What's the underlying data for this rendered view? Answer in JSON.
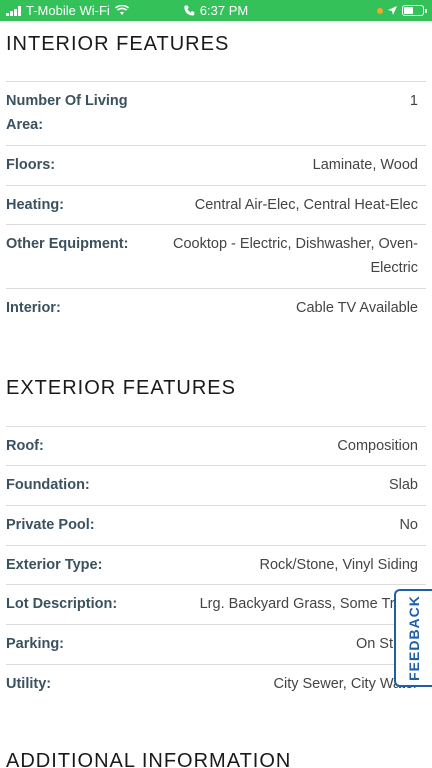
{
  "status_bar": {
    "carrier": "T-Mobile Wi-Fi",
    "time": "6:37 PM",
    "background_color": "#35c159",
    "battery_level": 0.55,
    "icons": [
      "signal-bars-icon",
      "wifi-icon",
      "phone-call-icon",
      "privacy-dot-icon",
      "battery-icon"
    ]
  },
  "interior": {
    "title": "INTERIOR FEATURES",
    "rows": [
      {
        "label": "Number Of Living Area:",
        "value": "1"
      },
      {
        "label": "Floors:",
        "value": "Laminate, Wood"
      },
      {
        "label": "Heating:",
        "value": "Central Air-Elec, Central Heat-Elec"
      },
      {
        "label": "Other Equipment:",
        "value": "Cooktop - Electric, Dishwasher, Oven-Electric"
      },
      {
        "label": "Interior:",
        "value": "Cable TV Available"
      }
    ]
  },
  "exterior": {
    "title": "EXTERIOR FEATURES",
    "rows": [
      {
        "label": "Roof:",
        "value": "Composition"
      },
      {
        "label": "Foundation:",
        "value": "Slab"
      },
      {
        "label": "Private Pool:",
        "value": "No"
      },
      {
        "label": "Exterior Type:",
        "value": "Rock/Stone, Vinyl Siding"
      },
      {
        "label": "Lot Description:",
        "value": "Lrg. Backyard Grass, Some Trees"
      },
      {
        "label": "Parking:",
        "value": "On Street"
      },
      {
        "label": "Utility:",
        "value": "City Sewer, City Water"
      }
    ]
  },
  "additional": {
    "title": "ADDITIONAL INFORMATION"
  },
  "feedback": {
    "label": "FEEDBACK",
    "color": "#1f5fa8"
  }
}
